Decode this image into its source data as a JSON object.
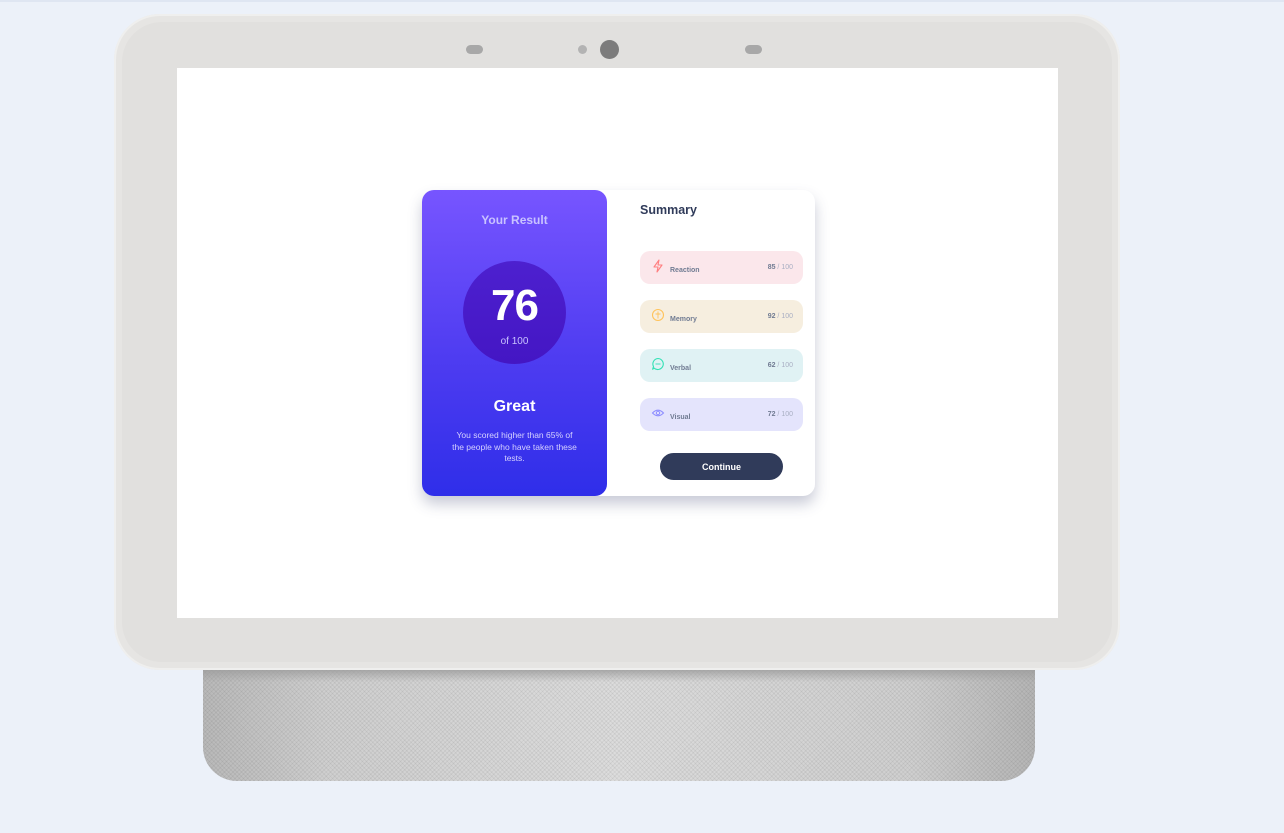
{
  "result": {
    "title": "Your Result",
    "score": "76",
    "score_max": "of 100",
    "rating": "Great",
    "description": "You scored higher than 65% of the people who have taken these tests."
  },
  "summary": {
    "title": "Summary",
    "items": [
      {
        "label": "Reaction",
        "score": "85",
        "max": " / 100",
        "icon": "lightning-icon",
        "color": "#ff7f80"
      },
      {
        "label": "Memory",
        "score": "92",
        "max": " / 100",
        "icon": "brain-icon",
        "color": "#ffc35b"
      },
      {
        "label": "Verbal",
        "score": "62",
        "max": " / 100",
        "icon": "chat-bubble-icon",
        "color": "#33e1b5"
      },
      {
        "label": "Visual",
        "score": "72",
        "max": " / 100",
        "icon": "eye-icon",
        "color": "#8e8eff"
      }
    ],
    "continue_label": "Continue"
  },
  "colors": {
    "gradient_top": "#7755ff",
    "gradient_bottom": "#2f2ee9",
    "button": "#303b5a",
    "item_background": "#e4e2fc",
    "page_background": "#ecf1f9"
  }
}
